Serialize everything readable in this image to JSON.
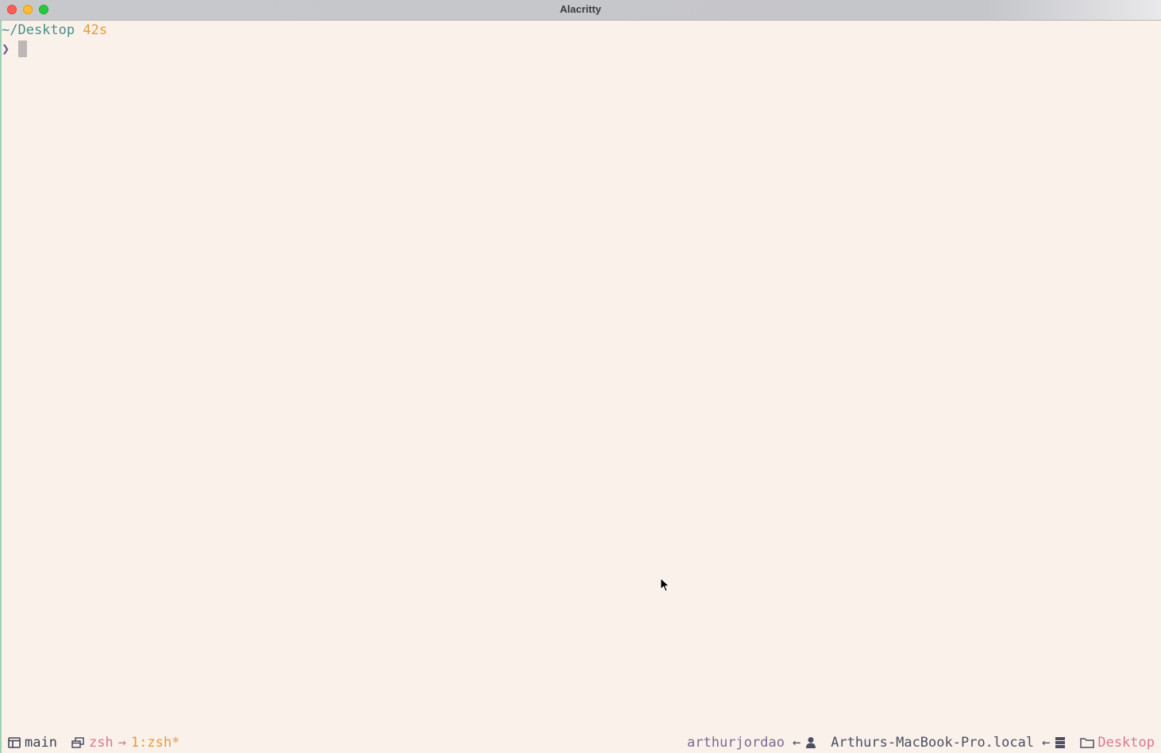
{
  "window": {
    "title": "Alacritty"
  },
  "terminal": {
    "prompt_path": "~/Desktop",
    "prompt_duration": "42s",
    "prompt_symbol": "❯"
  },
  "statusbar": {
    "session_icon": "window-icon",
    "session_name": "main",
    "window_icon": "windows-stack-icon",
    "window_name": "zsh",
    "arrow_right": "→",
    "window_index": "1:zsh*",
    "user": "arthurjordao",
    "arrow_left_1": "←",
    "user_icon": "user-icon",
    "host": "Arthurs-MacBook-Pro.local",
    "arrow_left_2": "←",
    "host_icon": "server-icon",
    "folder_icon": "folder-icon",
    "directory": "Desktop"
  },
  "colors": {
    "background": "#faf1ea",
    "cwd": "#4a8e8b",
    "duration": "#e49a3d",
    "prompt": "#6c5d9a",
    "accent_pink": "#d6788b"
  }
}
